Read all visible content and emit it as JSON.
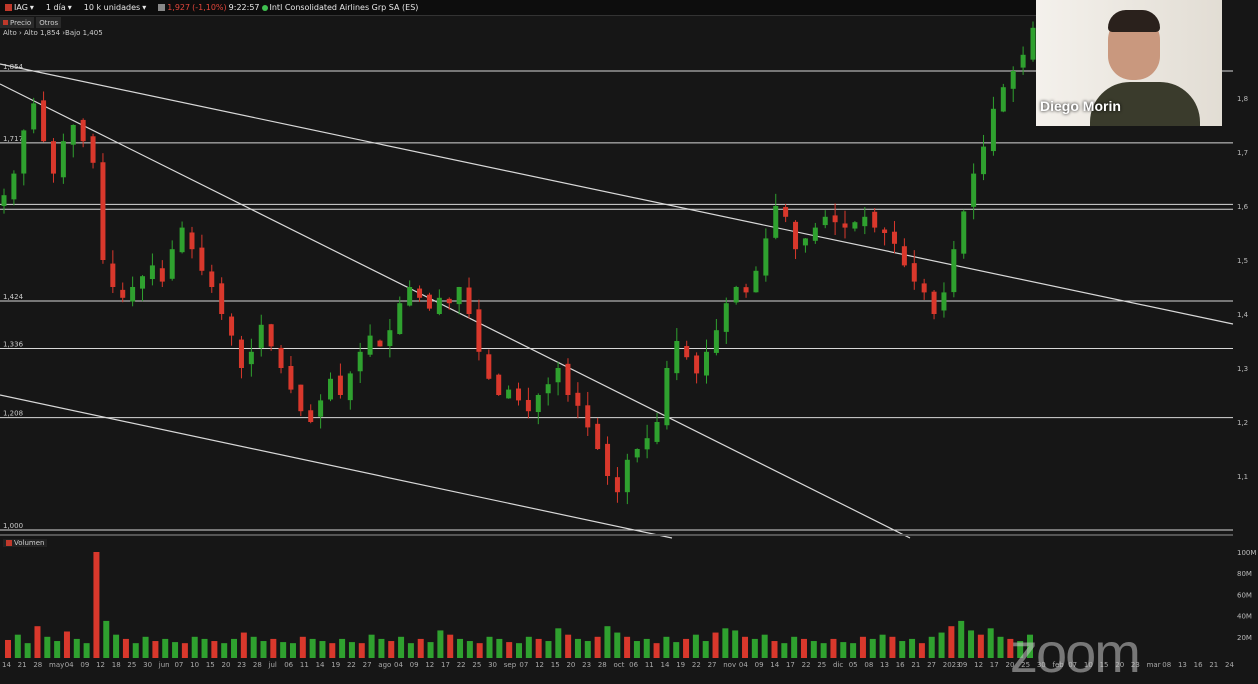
{
  "toolbar": {
    "ticker": "IAG",
    "interval": "1 día",
    "units": "10 k unidades",
    "last": "1,927",
    "change": "(-1,10%)",
    "time": "9:22:57",
    "company": "Intl Consolidated Airlines Grp SA (ES)"
  },
  "tabs": {
    "precio": "Precio",
    "otros": "Otros"
  },
  "hilo": "Alto › Alto 1,854 ›Bajo 1,405",
  "volume_label": "Volumen",
  "presenter": {
    "name": "Diego Morin"
  },
  "watermark": "zoom",
  "colors": {
    "up": "#2fa12f",
    "down": "#d9382c",
    "line": "#d8d8d8",
    "bg": "#161616"
  },
  "chart_data": [
    {
      "type": "candlestick",
      "title": "",
      "x_ticks": [
        "14",
        "21",
        "28",
        "may",
        "04",
        "09",
        "12",
        "18",
        "25",
        "30",
        "jun",
        "07",
        "10",
        "15",
        "20",
        "23",
        "28",
        "jul",
        "06",
        "11",
        "14",
        "19",
        "22",
        "27",
        "ago",
        "04",
        "09",
        "12",
        "17",
        "22",
        "25",
        "30",
        "sep",
        "07",
        "12",
        "15",
        "20",
        "23",
        "28",
        "oct",
        "06",
        "11",
        "14",
        "19",
        "22",
        "27",
        "nov",
        "04",
        "09",
        "14",
        "17",
        "22",
        "25",
        "dic",
        "05",
        "08",
        "13",
        "16",
        "21",
        "27",
        "2023",
        "09",
        "12",
        "17",
        "20",
        "25",
        "30",
        "feb",
        "07",
        "10",
        "15",
        "20",
        "23",
        "mar",
        "08",
        "13",
        "16",
        "21",
        "24"
      ],
      "y_ticks": [
        1.1,
        1.2,
        1.3,
        1.4,
        1.5,
        1.6,
        1.7,
        1.8
      ],
      "ylim": [
        1.0,
        1.9
      ],
      "horizontal_levels": [
        {
          "value": 1.85,
          "label": "1,854"
        },
        {
          "value": 1.717,
          "label": "1,717"
        },
        {
          "value": 1.603,
          "label": ""
        },
        {
          "value": 1.594,
          "label": ""
        },
        {
          "value": 1.424,
          "label": "1,424"
        },
        {
          "value": 1.336,
          "label": "1,336"
        },
        {
          "value": 1.208,
          "label": "1,208"
        },
        {
          "value": 1.0,
          "label": "1,000"
        }
      ],
      "close_path": [
        1.62,
        1.66,
        1.74,
        1.79,
        1.72,
        1.66,
        1.72,
        1.75,
        1.72,
        1.68,
        1.5,
        1.45,
        1.43,
        1.45,
        1.47,
        1.49,
        1.46,
        1.52,
        1.56,
        1.52,
        1.48,
        1.45,
        1.4,
        1.36,
        1.3,
        1.33,
        1.38,
        1.34,
        1.3,
        1.26,
        1.22,
        1.2,
        1.24,
        1.28,
        1.25,
        1.29,
        1.33,
        1.36,
        1.34,
        1.37,
        1.42,
        1.45,
        1.43,
        1.41,
        1.43,
        1.42,
        1.45,
        1.4,
        1.33,
        1.28,
        1.25,
        1.26,
        1.24,
        1.22,
        1.25,
        1.27,
        1.3,
        1.25,
        1.23,
        1.19,
        1.15,
        1.1,
        1.07,
        1.13,
        1.15,
        1.17,
        1.2,
        1.3,
        1.35,
        1.32,
        1.29,
        1.33,
        1.37,
        1.42,
        1.45,
        1.44,
        1.48,
        1.54,
        1.6,
        1.58,
        1.52,
        1.54,
        1.56,
        1.58,
        1.57,
        1.56,
        1.57,
        1.58,
        1.56,
        1.55,
        1.53,
        1.49,
        1.46,
        1.44,
        1.4,
        1.44,
        1.52,
        1.59,
        1.66,
        1.71,
        1.78,
        1.82,
        1.85,
        1.88,
        1.93
      ]
    },
    {
      "type": "bar",
      "title": "Volumen",
      "y_ticks": [
        "20M",
        "40M",
        "60M",
        "80M",
        "100M"
      ],
      "ylim": [
        0,
        100
      ],
      "values": [
        17,
        22,
        14,
        30,
        20,
        16,
        25,
        18,
        14,
        100,
        35,
        22,
        18,
        14,
        20,
        16,
        18,
        15,
        14,
        20,
        18,
        16,
        14,
        18,
        24,
        20,
        16,
        18,
        15,
        14,
        20,
        18,
        16,
        14,
        18,
        15,
        14,
        22,
        18,
        16,
        20,
        14,
        18,
        15,
        26,
        22,
        18,
        16,
        14,
        20,
        18,
        15,
        14,
        20,
        18,
        16,
        28,
        22,
        18,
        16,
        20,
        30,
        24,
        20,
        16,
        18,
        14,
        20,
        15,
        18,
        22,
        16,
        24,
        28,
        26,
        20,
        18,
        22,
        16,
        14,
        20,
        18,
        16,
        14,
        18,
        15,
        14,
        20,
        18,
        22,
        20,
        16,
        18,
        14,
        20,
        24,
        30,
        35,
        26,
        22,
        28,
        20,
        18,
        16,
        22
      ]
    }
  ]
}
